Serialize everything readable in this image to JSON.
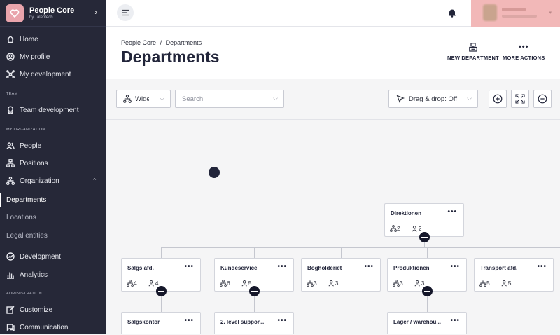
{
  "brand": {
    "title": "People Core",
    "subtitle": "by Talentech"
  },
  "sidebar": {
    "home": "Home",
    "my_profile": "My profile",
    "my_development": "My development",
    "section_team": "TEAM",
    "team_development": "Team development",
    "section_org": "MY ORGANIZATION",
    "people": "People",
    "positions": "Positions",
    "organization": "Organization",
    "departments": "Departments",
    "locations": "Locations",
    "legal_entities": "Legal entities",
    "development": "Development",
    "analytics": "Analytics",
    "section_admin": "ADMINISTRATION",
    "customize": "Customize",
    "communication": "Communication"
  },
  "header": {
    "breadcrumb_root": "People Core",
    "breadcrumb_sep": "/",
    "breadcrumb_current": "Departments",
    "title": "Departments",
    "new_department": "NEW DEPARTMENT",
    "more_actions": "MORE ACTIONS"
  },
  "toolbar": {
    "view_select": "Wide",
    "search_placeholder": "Search",
    "drag_drop": "Drag & drop: Off"
  },
  "org_chart": {
    "root": {
      "title": "Direktionen",
      "children": "2",
      "people": "2"
    },
    "level1": [
      {
        "title": "Salgs afd.",
        "children": "4",
        "people": "4"
      },
      {
        "title": "Kundeservice",
        "children": "6",
        "people": "5"
      },
      {
        "title": "Bogholderiet",
        "children": "3",
        "people": "3"
      },
      {
        "title": "Produktionen",
        "children": "3",
        "people": "3"
      },
      {
        "title": "Transport afd.",
        "children": "5",
        "people": "5"
      }
    ],
    "level2": [
      {
        "title": "Salgskontor"
      },
      {
        "title": "2. level suppor..."
      },
      {
        "title": "Lager / warehou..."
      }
    ]
  },
  "colors": {
    "sidebar_bg": "#262838",
    "accent_dark": "#22253a",
    "user_highlight": "#f2b8b8"
  }
}
